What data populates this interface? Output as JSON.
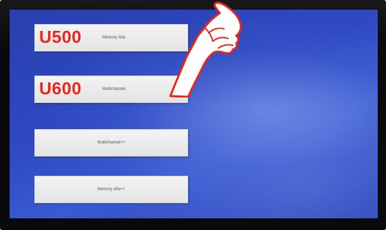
{
  "menu": {
    "buttons": [
      {
        "code": "U500",
        "label": "Memory Alfa"
      },
      {
        "code": "U600",
        "label": "Multichannel"
      },
      {
        "code": "",
        "label": "Multichannel++"
      },
      {
        "code": "",
        "label": "Memory Alfa++"
      }
    ]
  },
  "colors": {
    "screen_blue": "#2e49c2",
    "button_face": "#ececec",
    "code_red": "#e8261d",
    "bezel": "#0a0a0d"
  },
  "overlay": {
    "icon": "pointing-hand-icon"
  }
}
